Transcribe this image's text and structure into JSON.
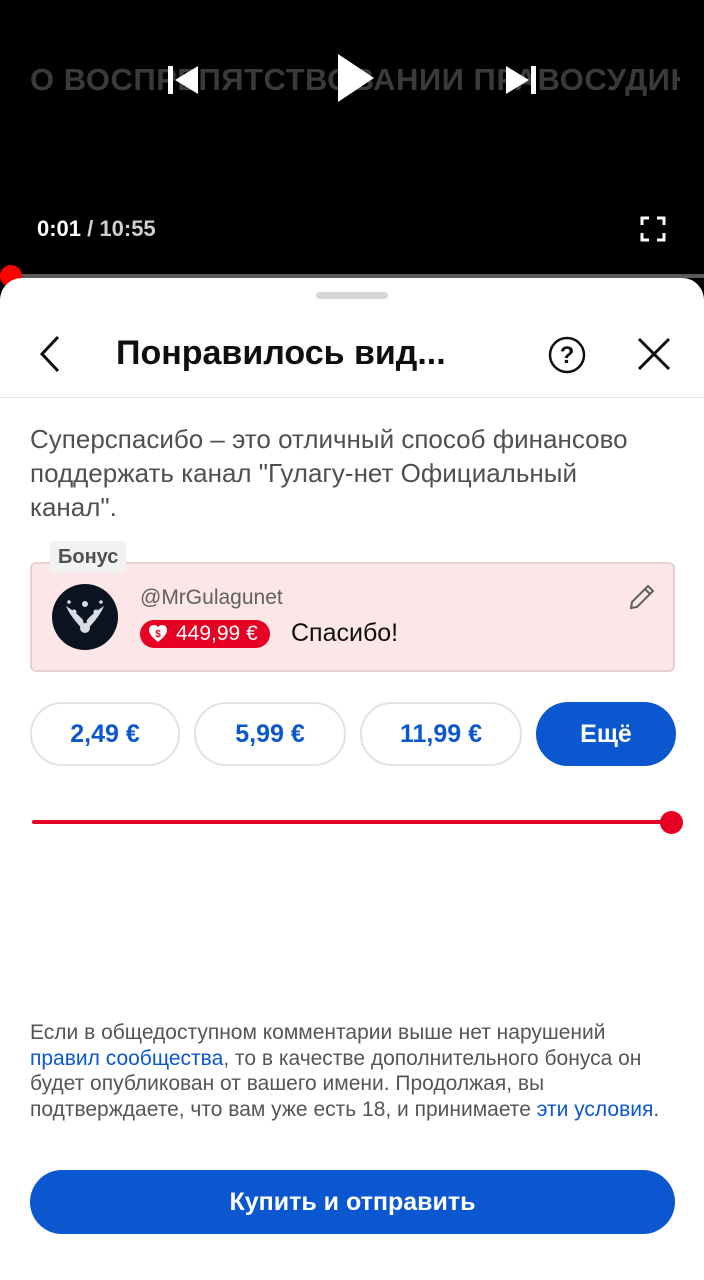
{
  "video": {
    "overlay_title": "О ВОСПРЕПЯТСТВОВАНИИ ПРАВОСУДИЮ",
    "current_time": "0:01",
    "separator": " / ",
    "duration": "10:55",
    "progress": 0.0015
  },
  "sheet": {
    "title": "Понравилось вид...",
    "description": "Суперспасибо – это отличный способ финансово поддержать канал \"Гулагу-нет Официальный канал\".",
    "bonus": {
      "tag": "Бонус",
      "handle": "@MrGulagunet",
      "amount": "449,99 €",
      "message": "Спасибо!"
    },
    "amounts": [
      "2,49 €",
      "5,99 €",
      "11,99 €"
    ],
    "more_label": "Ещё",
    "slider_value": 1.0,
    "disclaimer": {
      "part1": "Если в общедоступном комментарии выше нет нарушений ",
      "link1": "правил сообщества",
      "part2": ", то в качестве дополнительного бонуса он будет опубликован от вашего имени. Продолжая, вы подтверждаете, что вам уже есть 18, и принимаете ",
      "link2": "эти условия",
      "part3": "."
    },
    "buy_label": "Купить и отправить"
  },
  "colors": {
    "accent": "#0b57d0",
    "red": "#e60023",
    "bonus_bg": "#fce6e8"
  },
  "icons": [
    "previous-icon",
    "play-icon",
    "next-icon",
    "fullscreen-icon",
    "back-icon",
    "help-icon",
    "close-icon",
    "edit-pencil-icon",
    "super-thanks-icon"
  ]
}
